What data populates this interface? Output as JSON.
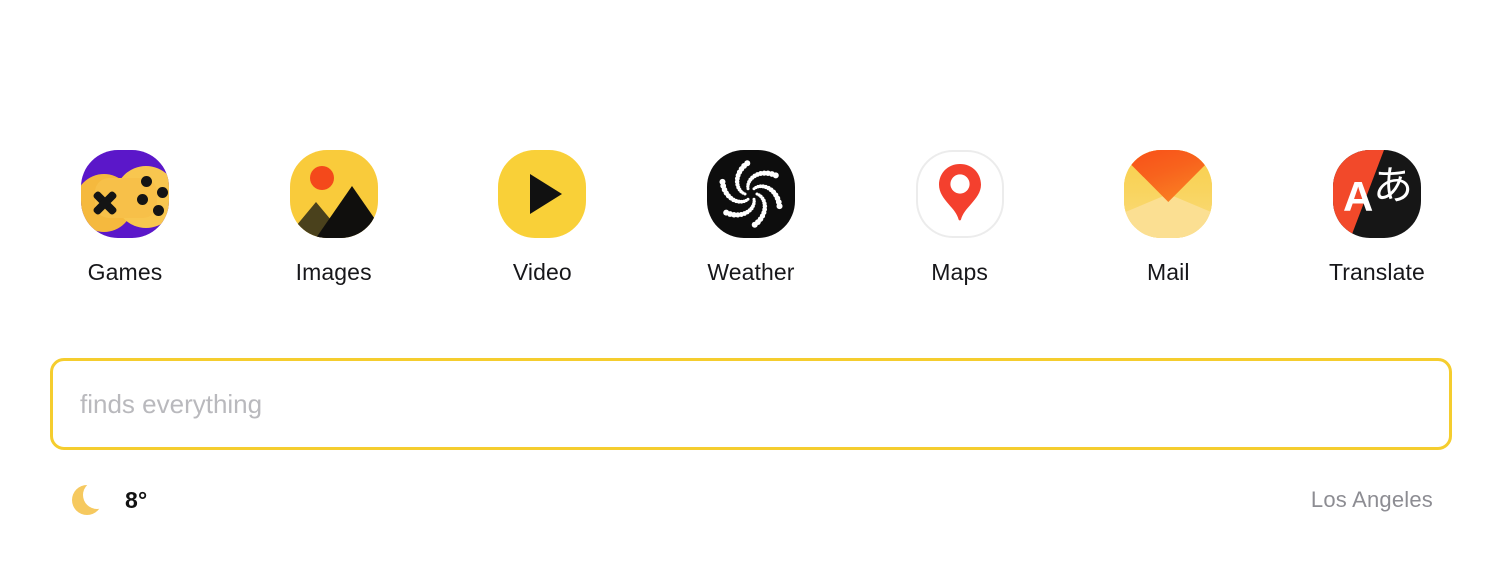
{
  "shortcuts": [
    {
      "id": "games",
      "label": "Games",
      "icon": "games-icon",
      "bg": "#5b17c9",
      "accent": "#f7c049"
    },
    {
      "id": "images",
      "label": "Images",
      "icon": "images-icon",
      "bg": "#f9cb3b",
      "accent": "#f4491b"
    },
    {
      "id": "video",
      "label": "Video",
      "icon": "video-play-icon",
      "bg": "#f9d038",
      "accent": "#111111"
    },
    {
      "id": "weather",
      "label": "Weather",
      "icon": "weather-swirl-icon",
      "bg": "#0d0d0d",
      "accent": "#ffffff"
    },
    {
      "id": "maps",
      "label": "Maps",
      "icon": "map-pin-icon",
      "bg": "#ffffff",
      "accent": "#f4402e"
    },
    {
      "id": "mail",
      "label": "Mail",
      "icon": "mail-envelope-icon",
      "bg": "#f8cf4a",
      "accent": "#f94e18"
    },
    {
      "id": "translate",
      "label": "Translate",
      "icon": "translate-icon",
      "bg": "#161616",
      "accent": "#f2492a"
    }
  ],
  "translate_icon": {
    "latin_glyph": "A",
    "japanese_glyph": "あ"
  },
  "search": {
    "value": "",
    "placeholder": "finds everything",
    "border_color": "#f5cd2e"
  },
  "status": {
    "weather_icon": "crescent-moon-icon",
    "temperature": "8°",
    "location": "Los Angeles",
    "moon_color": "#f6c95f",
    "location_color": "#8d8d93"
  }
}
